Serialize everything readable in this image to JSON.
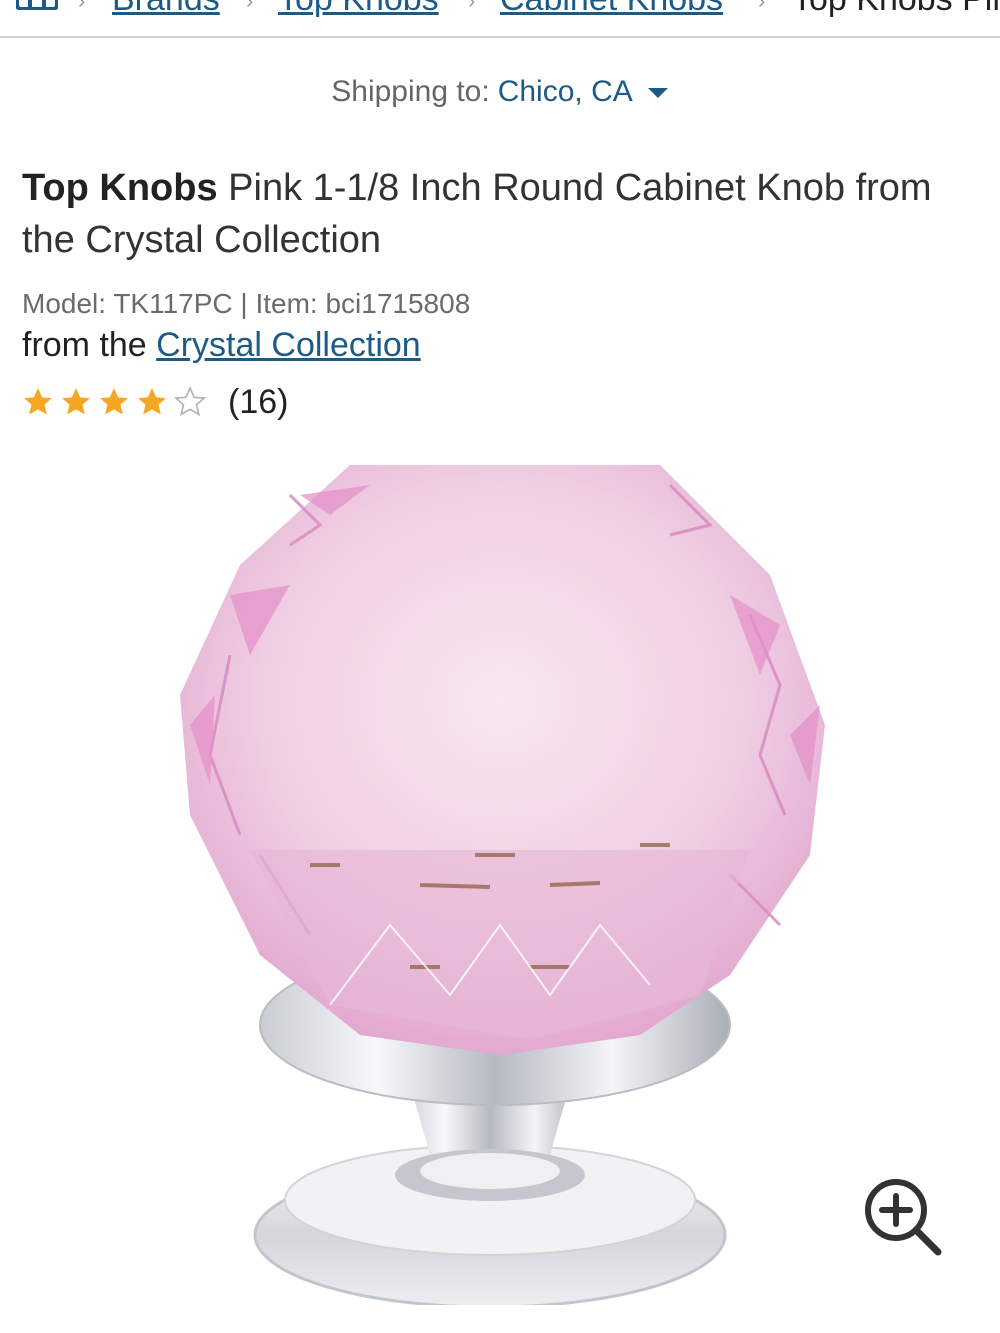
{
  "breadcrumb": {
    "items": [
      "Brands",
      "Top Knobs",
      "Cabinet Knobs"
    ],
    "current": "Top Knobs Pink"
  },
  "shipping": {
    "label": "Shipping to:",
    "location": "Chico, CA"
  },
  "product": {
    "brand": "Top Knobs",
    "name": "Pink 1-1/8 Inch Round Cabinet Knob from the Crystal Collection",
    "meta": "Model: TK117PC | Item: bci1715808",
    "collection_prefix": "from the",
    "collection_link": "Crystal Collection",
    "rating": 4,
    "rating_max": 5,
    "review_count": "(16)"
  },
  "colors": {
    "link": "#1d5a86",
    "star": "#f5a623",
    "star_empty": "#b5b5b5",
    "crystal": "#f2d3e6",
    "crystal_edge": "#d58bbf"
  },
  "icons": {
    "home": "home-grid-icon",
    "separator": "chevron-right-icon",
    "caret": "caret-down-icon",
    "star": "star-icon",
    "zoom": "zoom-in-icon"
  }
}
